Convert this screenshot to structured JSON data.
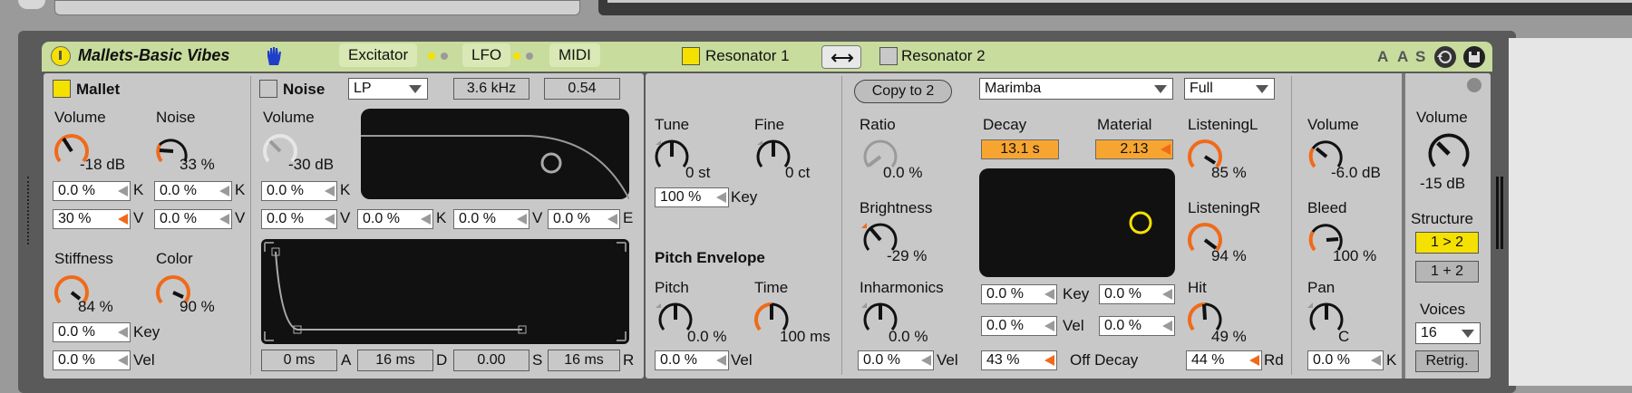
{
  "title": "Mallets-Basic Vibes",
  "tabs": {
    "excitator": "Excitator",
    "lfo": "LFO",
    "midi": "MIDI"
  },
  "header": {
    "resonator1": "Resonator 1",
    "resonator2": "Resonator 2",
    "a1": "A",
    "a2": "A",
    "s": "S"
  },
  "mallet": {
    "title": "Mallet",
    "volume_label": "Volume",
    "volume_value": "-18 dB",
    "noise_label": "Noise",
    "noise_value": "33 %",
    "row1": {
      "v1": "0.0 %",
      "s1": "K",
      "v2": "0.0 %",
      "s2": "K"
    },
    "row2": {
      "v1": "30 %",
      "s1": "V",
      "v2": "0.0 %",
      "s2": "V"
    },
    "stiffness_label": "Stiffness",
    "stiffness_value": "84 %",
    "color_label": "Color",
    "color_value": "90 %",
    "key_value": "0.0 %",
    "key_label": "Key",
    "vel_value": "0.0 %",
    "vel_label": "Vel"
  },
  "noise": {
    "title": "Noise",
    "filter_type": "LP",
    "freq": "3.6 kHz",
    "q": "0.54",
    "volume_label": "Volume",
    "volume_value": "-30 dB",
    "k_value": "0.0 %",
    "k_label": "K",
    "mods": [
      {
        "value": "0.0 %",
        "label": "V"
      },
      {
        "value": "0.0 %",
        "label": "K"
      },
      {
        "value": "0.0 %",
        "label": "V"
      },
      {
        "value": "0.0 %",
        "label": "E"
      }
    ],
    "env": [
      {
        "value": "0 ms",
        "label": "A"
      },
      {
        "value": "16 ms",
        "label": "D"
      },
      {
        "value": "0.00",
        "label": "S"
      },
      {
        "value": "16 ms",
        "label": "R"
      }
    ]
  },
  "tuning": {
    "tune_label": "Tune",
    "tune_value": "0 st",
    "fine_label": "Fine",
    "fine_value": "0 ct",
    "key_value": "100 %",
    "key_label": "Key",
    "pitch_env_title": "Pitch Envelope",
    "pitch_label": "Pitch",
    "pitch_value": "0.0 %",
    "time_label": "Time",
    "time_value": "100 ms",
    "vel_value": "0.0 %",
    "vel_label": "Vel"
  },
  "resonator": {
    "copy_button": "Copy to 2",
    "type": "Marimba",
    "quality": "Full",
    "ratio_label": "Ratio",
    "ratio_value": "0.0 %",
    "decay_label": "Decay",
    "decay_value": "13.1 s",
    "material_label": "Material",
    "material_value": "2.13",
    "brightness_label": "Brightness",
    "brightness_value": "-29 %",
    "inharmonics_label": "Inharmonics",
    "inharmonics_value": "0.0 %",
    "listL_label": "ListeningL",
    "listL_value": "85 %",
    "listR_label": "ListeningR",
    "listR_value": "94 %",
    "hit_label": "Hit",
    "hit_value": "49 %",
    "key_row": {
      "v1": "0.0 %",
      "label": "Key",
      "v2": "0.0 %"
    },
    "vel_row": {
      "v1": "0.0 %",
      "label": "Vel",
      "v2": "0.0 %"
    },
    "inharm_vel_value": "0.0 %",
    "inharm_vel_label": "Vel",
    "off_decay_value": "43 %",
    "off_decay_label": "Off Decay",
    "hit_rd_value": "44 %",
    "hit_rd_label": "Rd"
  },
  "output": {
    "volume_label": "Volume",
    "volume_value": "-6.0 dB",
    "bleed_label": "Bleed",
    "bleed_value": "100 %",
    "pan_label": "Pan",
    "pan_value": "C",
    "k_value": "0.0 %",
    "k_label": "K"
  },
  "global": {
    "volume_label": "Volume",
    "volume_value": "-15 dB",
    "structure_label": "Structure",
    "structure_1": "1 > 2",
    "structure_2": "1 + 2",
    "voices_label": "Voices",
    "voices_value": "16",
    "retrig": "Retrig."
  },
  "colors": {
    "accent": "#f06a1a",
    "title_bar": "#c8dc9e",
    "highlight": "#f7e600",
    "value_highlight": "#f7a531"
  }
}
